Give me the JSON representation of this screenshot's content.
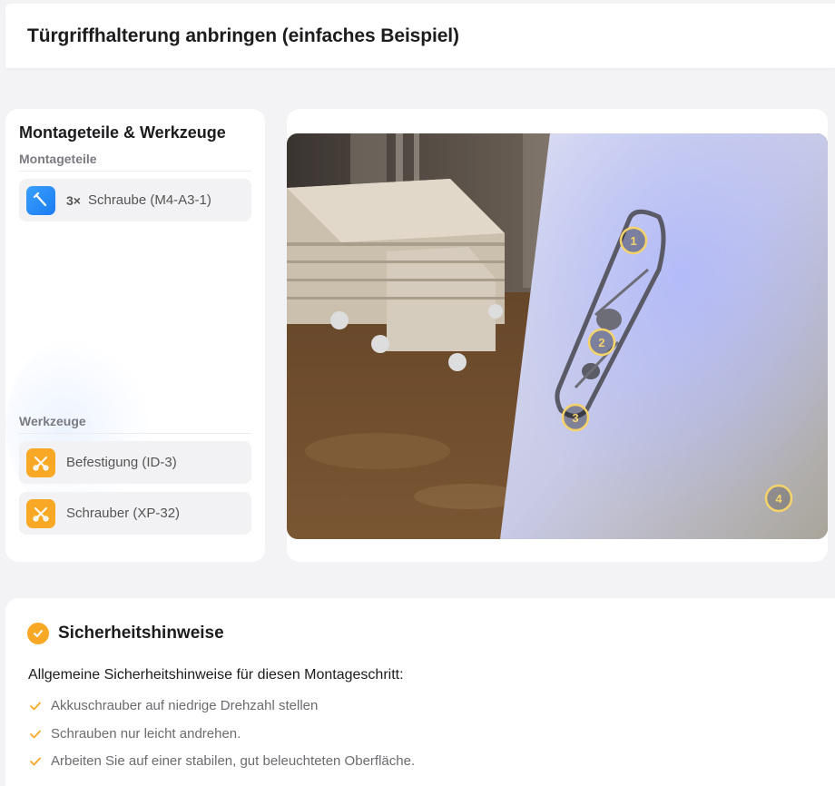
{
  "header": {
    "title": "Türgriffhalterung anbringen (einfaches Beispiel)"
  },
  "parts_panel": {
    "title": "Montageteile & Werkzeuge",
    "parts_label": "Montageteile",
    "parts": [
      {
        "qty": "3×",
        "name": "Schraube (M4-A3-1)",
        "icon": "screw-icon"
      }
    ],
    "tools_label": "Werkzeuge",
    "tools": [
      {
        "name": "Befestigung (ID-3)",
        "icon": "tools-icon"
      },
      {
        "name": "Schrauber (XP-32)",
        "icon": "tools-icon"
      }
    ]
  },
  "photo": {
    "markers": [
      "1",
      "2",
      "3",
      "4"
    ]
  },
  "safety": {
    "title": "Sicherheitshinweise",
    "intro": "Allgemeine Sicherheitshinweise für diesen Montageschritt:",
    "items": [
      "Akkuschrauber auf niedrige Drehzahl stellen",
      "Schrauben nur leicht andrehen.",
      "Arbeiten Sie auf einer stabilen, gut beleuchteten Oberfläche."
    ]
  },
  "colors": {
    "accent": "#f9a825",
    "blue_icon": "#1a7cf0",
    "marker": "#f5d36b"
  }
}
